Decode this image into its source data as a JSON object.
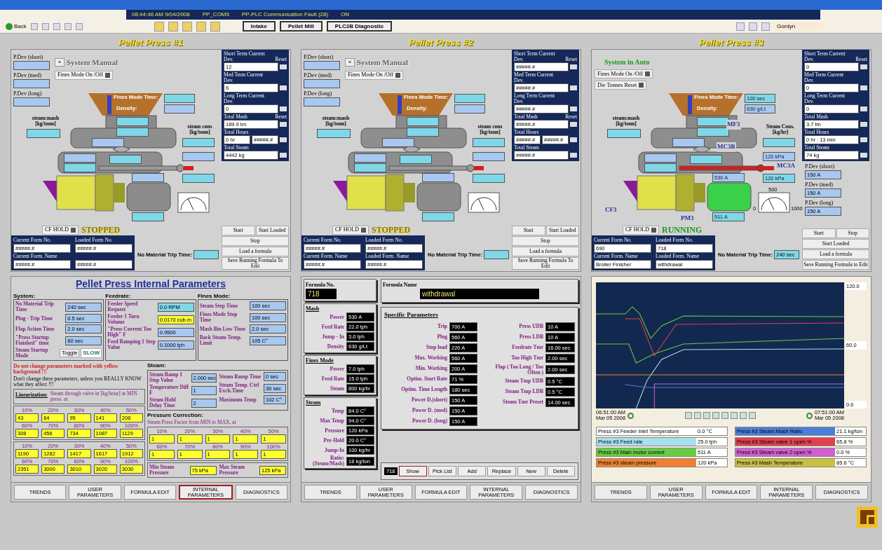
{
  "status_bar": {
    "items": [
      "08:44:46 AM 9/04/2008",
      "PP_COM5",
      "PP-PLC Communication Fault (28)",
      "ON"
    ]
  },
  "toolbar": {
    "back": "Back",
    "buttons": [
      "Intake",
      "Pellet Mill",
      "PLC2B Diagnostic"
    ],
    "user": "Gordyn"
  },
  "presses": [
    {
      "title": "Pellet Press #1",
      "pdev": [
        {
          "label": "P.Dev (short)"
        },
        {
          "label": "P.Dev (med)"
        },
        {
          "label": "P.Dev (long)"
        }
      ],
      "mode": {
        "kind": "manual",
        "button": "»",
        "label": "System Manual"
      },
      "switches": [
        "Fines Mode On /Off"
      ],
      "diagram_labels": {
        "fines_time": "Fines Mode Time:",
        "density": "Density:",
        "steam_mash": "steam:mash [kg/tonn]",
        "steam_cons": "steam cons [kg/tonn]"
      },
      "running": false,
      "hold": "CF HOLD",
      "state": "STOPPED",
      "stats": [
        {
          "label": "Short Term Current Dev.",
          "values": [
            "12"
          ],
          "reset": "Reset"
        },
        {
          "label": "Med Term Current Dev.",
          "values": [
            "6"
          ]
        },
        {
          "label": "Long Term Current Dev.",
          "values": [
            "0"
          ]
        },
        {
          "label": "Total Mash",
          "values": [
            "189.9  tm"
          ],
          "reset": "Reset"
        },
        {
          "label": "Total Hours",
          "values": [
            "0  hr",
            "#####.#"
          ]
        },
        {
          "label": "Total Steam",
          "values": [
            "4442  kg"
          ]
        }
      ],
      "form": [
        {
          "label": "Current Form No.",
          "value": "#####.#"
        },
        {
          "label": "Loaded Form No.",
          "value": "#####.#"
        },
        {
          "label": "Current Form. Name",
          "value": "#####.#"
        },
        {
          "value": "#####.#"
        }
      ],
      "trip": {
        "label": "No Material Trip Time:"
      },
      "buttons": [
        [
          "Start",
          "Start Loaded"
        ],
        [
          "Stop"
        ],
        [
          "Load a formula"
        ],
        [
          "Save Running Formula To Edit"
        ]
      ]
    },
    {
      "title": "Pellet Press #2",
      "pdev": [
        {
          "label": "P.Dev (short)"
        },
        {
          "label": "P.Dev (med)"
        },
        {
          "label": "P.Dev (long)"
        }
      ],
      "mode": {
        "kind": "manual",
        "button": "»",
        "label": "System Manual"
      },
      "switches": [
        "Fines Mode On /Off"
      ],
      "diagram_labels": {
        "fines_time": "Fines Mode Time:",
        "density": "Density:",
        "steam_mash": "steam:mash [kg/tonn]",
        "steam_cons": "steam cons [kg/tonn]"
      },
      "running": false,
      "hold": "CF HOLD",
      "state": "STOPPED",
      "stats": [
        {
          "label": "Short Term Current Dev.",
          "values": [
            "#####.#"
          ],
          "reset": "Reset"
        },
        {
          "label": "Med Term Current Dev.",
          "values": [
            "#####.#"
          ]
        },
        {
          "label": "Long Term Current Dev.",
          "values": [
            "#####.#"
          ]
        },
        {
          "label": "Total Mash",
          "values": [
            "#####.#"
          ],
          "reset": "Reset"
        },
        {
          "label": "Total Hours",
          "values": [
            "#####.#",
            "#####.#"
          ]
        },
        {
          "label": "Total Steam",
          "values": [
            "#####.#"
          ]
        }
      ],
      "form": [
        {
          "label": "Current Form No.",
          "value": "#####.#"
        },
        {
          "label": "Loaded Form No.",
          "value": "#####.#"
        },
        {
          "label": "Current Form. Name",
          "value": "#####.#"
        },
        {
          "label": "Loaded Form. Name",
          "value": "#####.#"
        }
      ],
      "trip": {
        "label": "No Material Trip Time:"
      },
      "buttons": [
        [
          "Start",
          "Start Loaded"
        ],
        [
          "Stop"
        ],
        [
          "Load a formula"
        ],
        [
          "Save Running Formula To Edit"
        ]
      ]
    },
    {
      "title": "Pellet Press #3",
      "pdev": [
        {
          "label": "P.Dev (short)",
          "value": "150 A"
        },
        {
          "label": "P.Dev (med)",
          "value": "150 A"
        },
        {
          "label": "P.Dev (long)",
          "value": "150 A"
        }
      ],
      "mode": {
        "kind": "auto",
        "label": "System in Auto"
      },
      "switches": [
        "Fines Mode On /Off",
        "Die Tonnes Reset"
      ],
      "diagram_labels": {
        "fines_time": "Fines Mode Time:",
        "density": "Density:",
        "steam_mash": "steam:mash [kg/tonn]",
        "steam_cons": "Steam Cons. [kg/hr]"
      },
      "readings": {
        "fines_time": "100 sec",
        "density": "630 g/Lt",
        "motor_top": "530 A",
        "motor_bottom": "511 A",
        "pipe_1": "120 kPa",
        "pipe_2": "120 kPa"
      },
      "tags": [
        "MF3",
        "MC3B",
        "MC3A",
        "CF3",
        "PM3"
      ],
      "gauge": [
        "0",
        "500",
        "1000"
      ],
      "running": true,
      "hold": "CF HOLD",
      "state": "RUNNING",
      "stats": [
        {
          "label": "Short Term Current Dev.",
          "values": [
            "0"
          ],
          "reset": "Reset"
        },
        {
          "label": "Med Term Current Dev.",
          "values": [
            "0"
          ]
        },
        {
          "label": "Long Term Current Dev.",
          "values": [
            "0"
          ]
        },
        {
          "label": "Total Mash",
          "values": [
            "3.7  tm"
          ]
        },
        {
          "label": "Total Hours",
          "values": [
            "0  hr  : 13  min"
          ]
        },
        {
          "label": "Total Steam",
          "values": [
            "74  kg"
          ]
        }
      ],
      "form": [
        {
          "label": "Current Form No.",
          "value": "690"
        },
        {
          "label": "Loaded Form No.",
          "value": "718"
        },
        {
          "label": "Current Form. Name",
          "value": "Broiler Finisher"
        },
        {
          "label": "Loaded Form. Name",
          "value": "withdrawal"
        }
      ],
      "trip": {
        "label": "No Material Trip Time:",
        "value": "240 sec"
      },
      "buttons": [
        [
          "Start",
          "Stop"
        ],
        [
          "Start Loaded"
        ],
        [
          "Load a formula"
        ],
        [
          "Save Running Formula to Edit"
        ]
      ]
    }
  ],
  "internal": {
    "title": "Pellet Press Internal Parameters",
    "sections": [
      {
        "title": "System:",
        "rows": [
          {
            "label": "No Material Trip Time",
            "value": "240 sec",
            "kind": "setting"
          },
          {
            "label": "Plug - Trip Time",
            "value": "0.5 sec",
            "kind": "setting"
          },
          {
            "label": "Flap Action Time",
            "value": "2.0 sec",
            "kind": "setting"
          },
          {
            "label": "\"Press Startup Finished\" time",
            "value": "60 sec",
            "kind": "setting"
          }
        ],
        "toggle": {
          "label": "Steam Startup Mode",
          "button": "Toggle",
          "value": "SLOW"
        }
      },
      {
        "title": "Feedrate:",
        "rows": [
          {
            "label": "Feeder Speed Request",
            "value": "0.0 RPM",
            "kind": "live"
          },
          {
            "label": "Feeder 1 Turn Volume",
            "value": "0.0170 cub.m",
            "kind": "locked"
          },
          {
            "label": "\"Press Current Too High\" F",
            "value": "0.9500",
            "kind": "setting"
          },
          {
            "label": "Feed Ramping 1 Step Value",
            "value": "0.1000 tph",
            "kind": "setting"
          }
        ]
      },
      {
        "title": "Fines Mode:",
        "rows": [
          {
            "label": "Steam Step Time",
            "value": "100 sec",
            "kind": "setting"
          },
          {
            "label": "Fines Mode Stop Time",
            "value": "100 sec",
            "kind": "setting"
          },
          {
            "label": "Mash Bin Low Time",
            "value": "2.0 sec",
            "kind": "setting"
          },
          {
            "label": "Back Steam Temp. Limit",
            "value": "105 C°",
            "kind": "setting"
          }
        ]
      }
    ],
    "warning": "Do not change parameters marked with yellow background !!!",
    "caution": "Don't change these parameters, unless you REALLY KNOW what they affect !!!",
    "steam": {
      "title": "Steam:",
      "left": [
        {
          "label": "Steam Ramp 1 Step Value",
          "value": "2.000 sec",
          "kind": "setting"
        },
        {
          "label": "Temperature Diff F",
          "value": "1",
          "kind": "setting"
        },
        {
          "label": "Steam Hold Delay Time",
          "value": "2",
          "kind": "setting"
        }
      ],
      "right": [
        {
          "label": "Steam Ramp Time",
          "value": "0 sec",
          "kind": "setting"
        },
        {
          "label": "Steam Temp. Ctrl Exch.Time",
          "value": "30 sec",
          "kind": "setting"
        },
        {
          "label": "Maximum Temp",
          "value": "102 C°",
          "kind": "setting"
        }
      ]
    },
    "linearization": {
      "title": "Linearization:",
      "text": "Steam through valve in [kg/hour] at MIN press. at",
      "tables": [
        [
          {
            "pct": "10%",
            "value": "43"
          },
          {
            "pct": "20%",
            "value": "64"
          },
          {
            "pct": "30%",
            "value": "95"
          },
          {
            "pct": "40%",
            "value": "141"
          },
          {
            "pct": "50%",
            "value": "208"
          },
          {
            "pct": "60%",
            "value": "308"
          },
          {
            "pct": "70%",
            "value": "456"
          },
          {
            "pct": "80%",
            "value": "734"
          },
          {
            "pct": "90%",
            "value": "1087"
          },
          {
            "pct": "100%",
            "value": "1129"
          }
        ],
        [
          {
            "pct": "10%",
            "value": "1190"
          },
          {
            "pct": "20%",
            "value": "1282"
          },
          {
            "pct": "30%",
            "value": "1417"
          },
          {
            "pct": "40%",
            "value": "1617"
          },
          {
            "pct": "50%",
            "value": "1912"
          },
          {
            "pct": "60%",
            "value": "2351"
          },
          {
            "pct": "70%",
            "value": "3000"
          },
          {
            "pct": "80%",
            "value": "3010"
          },
          {
            "pct": "90%",
            "value": "3020"
          },
          {
            "pct": "100%",
            "value": "3030"
          }
        ]
      ]
    },
    "pressure": {
      "title": "Pressure Correction:",
      "text": "Steam Press Factor from MIN to MAX, at",
      "table": [
        {
          "pct": "10%",
          "value": "1"
        },
        {
          "pct": "20%",
          "value": "1"
        },
        {
          "pct": "30%",
          "value": "1"
        },
        {
          "pct": "40%",
          "value": "1"
        },
        {
          "pct": "50%",
          "value": "1"
        },
        {
          "pct": "60%",
          "value": "1"
        },
        {
          "pct": "70%",
          "value": "1"
        },
        {
          "pct": "80%",
          "value": "1"
        },
        {
          "pct": "90%",
          "value": "1"
        },
        {
          "pct": "100%",
          "value": "1"
        }
      ],
      "limits": [
        {
          "label": "Min Steam Pressure",
          "value": "75 kPa"
        },
        {
          "label": "Max Steam Pressure",
          "value": "125 kPa"
        }
      ]
    },
    "nav": [
      {
        "label": "TRENDS",
        "selected": false
      },
      {
        "label": "USER PARAMETERS",
        "selected": false
      },
      {
        "label": "FORMULA EDIT",
        "selected": false
      },
      {
        "label": "INTERNAL PARAMETERS",
        "selected": true
      },
      {
        "label": "DIAGNOSTICS",
        "selected": false
      }
    ]
  },
  "formula": {
    "number_label": "Formula No.",
    "number": "718",
    "name_label": "Formula Name",
    "name": "withdrawal",
    "groups": [
      {
        "title": "Mash",
        "rows": [
          {
            "label": "Power",
            "value": "530 A"
          },
          {
            "label": "Feed Rate",
            "value": "22.0 tph"
          },
          {
            "label": "Jump - In",
            "value": "3.0 tph"
          },
          {
            "label": "Density",
            "value": "630 g/Lt"
          }
        ]
      },
      {
        "title": "Fines Mode",
        "rows": [
          {
            "label": "Power",
            "value": "7.0 tph"
          },
          {
            "label": "Feed Rate",
            "value": "15.0 tph"
          },
          {
            "label": "Steam",
            "value": "800 kg/hr"
          }
        ]
      },
      {
        "title": "Steam",
        "rows": [
          {
            "label": "Temp",
            "value": "84.0 C°"
          },
          {
            "label": "Max Temp",
            "value": "94.0 C°"
          },
          {
            "label": "Pressure",
            "value": "120 kPa"
          },
          {
            "label": "Pre-Hold",
            "value": "20.0 C°"
          },
          {
            "label": "Jump-In",
            "value": "100 kg/hr"
          },
          {
            "label": "Ratio: (Steam/Mash)",
            "value": "18  kg/ton"
          }
        ]
      }
    ],
    "specific_title": "Specific Parameters",
    "specific_left": [
      {
        "label": "Trip",
        "value": "700 A"
      },
      {
        "label": "Plug",
        "value": "560 A"
      },
      {
        "label": "Stop load",
        "value": "220 A"
      },
      {
        "label": "Max. Working",
        "value": "560 A"
      },
      {
        "label": "Min. Working",
        "value": "200 A"
      },
      {
        "label": "Optim. Start Rate",
        "value": "71 %"
      },
      {
        "label": "Optim. Time Length",
        "value": "180 sec"
      },
      {
        "label": "Power D.(short)",
        "value": "150 A"
      },
      {
        "label": "Power D. (med)",
        "value": "150 A"
      },
      {
        "label": "Power D. (long)",
        "value": "150 A"
      }
    ],
    "specific_right": [
      {
        "label": "Press UDB",
        "value": "10 A"
      },
      {
        "label": "Press LDB",
        "value": "10 A"
      },
      {
        "label": "Feedrate Tmr",
        "value": "16.00 sec"
      },
      {
        "label": "Too High Tmr",
        "value": "2.00 sec"
      },
      {
        "label": "Flap ( Too Long / Too Often )",
        "value": "2.00 sec"
      },
      {
        "label": "Steam Tmp UDB",
        "value": "0.5 °C"
      },
      {
        "label": "Steam Tmp LDB",
        "value": "0.5 °C"
      },
      {
        "label": "Steam Tmr Preset",
        "value": "14.00 sec"
      }
    ],
    "bar_value": "718",
    "actions": [
      {
        "label": "Show",
        "selected": true
      },
      {
        "label": "Pick List",
        "selected": false
      },
      {
        "label": "Add",
        "selected": false
      },
      {
        "label": "Replace",
        "selected": false
      },
      {
        "label": "New",
        "selected": false
      },
      {
        "label": "Delete",
        "selected": false
      }
    ],
    "nav": [
      {
        "label": "TRENDS",
        "selected": false
      },
      {
        "label": "USER PARAMETERS",
        "selected": false
      },
      {
        "label": "FORMULA EDIT",
        "selected": false
      },
      {
        "label": "INTERNAL PARAMETERS",
        "selected": false
      },
      {
        "label": "DIAGNOSTICS",
        "selected": false
      }
    ]
  },
  "trend": {
    "y_labels": [
      "120.0",
      "60.0",
      "0.0"
    ],
    "start": [
      "06:51:00 AM",
      "Mar 05 2008"
    ],
    "end": [
      "07:51:00 AM",
      "Mar 05 2008"
    ],
    "legend": [
      {
        "label": "Press #3 Feeder inlet Temperature",
        "value": "0.0 °C",
        "color": "#ffffff"
      },
      {
        "label": "Press #3 Feed rate",
        "value": "25.0 tph",
        "color": "#a8e0f0"
      },
      {
        "label": "Press #3 Main motor current",
        "value": "511 A",
        "color": "#66cc44"
      },
      {
        "label": "Press #3 steam pressure",
        "value": "120 kPa",
        "color": "#f08030"
      },
      {
        "label": "Press #3 Steam:Mash Ratio",
        "value": "21.1 kg/ton",
        "color": "#4a7ed8"
      },
      {
        "label": "Press #3 Steam valve 1 open %",
        "value": "65.8 %",
        "color": "#e04050"
      },
      {
        "label": "Press #3 Steam valve 2 open %",
        "value": "0.0 %",
        "color": "#d060d0"
      },
      {
        "label": "Press #3 Mash Temperature",
        "value": "85.6 °C",
        "color": "#c8c040"
      }
    ],
    "nav": [
      {
        "label": "TRENDS",
        "selected": false
      },
      {
        "label": "USER PARAMETERS",
        "selected": false
      },
      {
        "label": "FORMULA EDIT",
        "selected": false
      },
      {
        "label": "INTERNAL PARAMETERS",
        "selected": false
      },
      {
        "label": "DIAGNOSTICS",
        "selected": false
      }
    ]
  }
}
